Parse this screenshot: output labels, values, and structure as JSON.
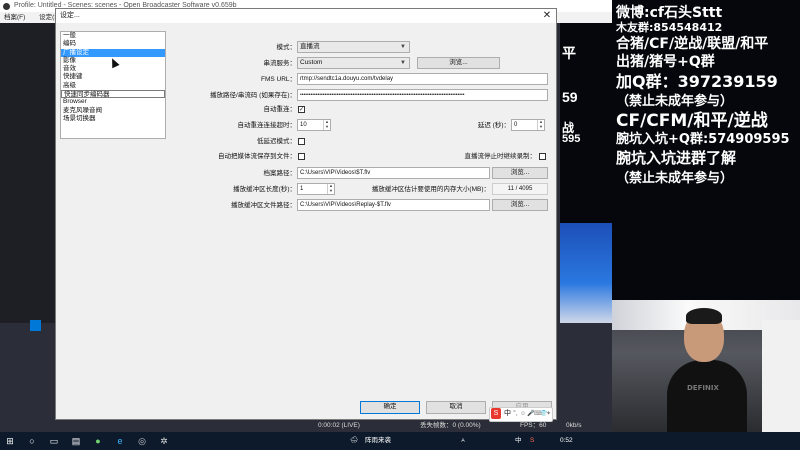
{
  "obs": {
    "title": "Profile: Untitled - Scenes: scenes - Open Broadcaster Software v0.659b",
    "menu": [
      "档案(F)",
      "设定(S)"
    ],
    "status": {
      "time": "0:00:02 (LIVE)",
      "dropped": "丢失帧数：0 (0.00%)",
      "fps": "FPS：60",
      "bitrate": "0kb/s"
    }
  },
  "overlay": {
    "lines": [
      "微博:cf石头Sttt",
      "木友群:854548412",
      "合猪/CF/逆战/联盟/和平",
      "出猪/猪号+Q群",
      "加Q群：397239159",
      "（禁止未成年参与）",
      "CF/CFM/和平/逆战",
      "腕坑入坑+Q群:574909595",
      "腕坑入坑进群了解",
      "（禁止未成年参与）"
    ],
    "bleed": [
      "平",
      "59",
      "战",
      "595"
    ],
    "shirt": "DEFINIX"
  },
  "dialog": {
    "title": "设定...",
    "close": "✕",
    "categories": [
      "一般",
      "编码",
      "广播设定",
      "影像",
      "音效",
      "快捷键",
      "高级",
      "快速同步编码器",
      "Browser",
      "麦克风噪音阀",
      "场景切换器"
    ],
    "selected_index": 2,
    "mode_label": "模式：",
    "mode_value": "直播流",
    "service_label": "串流服务：",
    "service_value": "Custom",
    "browse_label": "浏览...",
    "fms_label": "FMS URL：",
    "fms_value": "rtmp://sendtc1a.douyu.com/tvdelay",
    "key_label": "播放路径/串流码 (如果存在)：",
    "key_value": "••••••••••••••••••••••••••••••••••••••••••••••••••••••••••••••••••••••••••••••••••••••••••••••",
    "autoreconnect_label": "自动重连：",
    "autoreconnect_checked": true,
    "reconnect_timeout_label": "自动重连连接超时：",
    "reconnect_timeout_value": "10",
    "delay_label": "延迟 (秒)：",
    "delay_value": "0",
    "lowlatency_label": "低延迟模式：",
    "autosave_label": "自动把媒体流保存到文件：",
    "keep_recording_label": "直播流停止时继续录制：",
    "filepath_label": "档案路径：",
    "filepath_value": "C:\\Users\\VIP\\Videos\\$T.flv",
    "replay_length_label": "播放缓冲区长度(秒)：",
    "replay_length_value": "1",
    "replay_mem_label": "播放缓冲区估计要使用的内存大小(MB)：",
    "replay_mem_value": "11 / 4095",
    "replay_path_label": "播放缓冲区文件路径：",
    "replay_path_value": "C:\\Users\\VIP\\Videos\\Replay-$T.flv",
    "ok_label": "确定",
    "cancel_label": "取消",
    "apply_label": "应用"
  },
  "ime": {
    "logo": "S",
    "lang": "中",
    "items": [
      "°,",
      "☺",
      "🎤",
      "⌨",
      "👕",
      "✦"
    ]
  },
  "taskbar": {
    "weather": "阵雨来袭",
    "clock": "0:52",
    "tray": [
      "ㅅ",
      "中",
      "S"
    ]
  }
}
